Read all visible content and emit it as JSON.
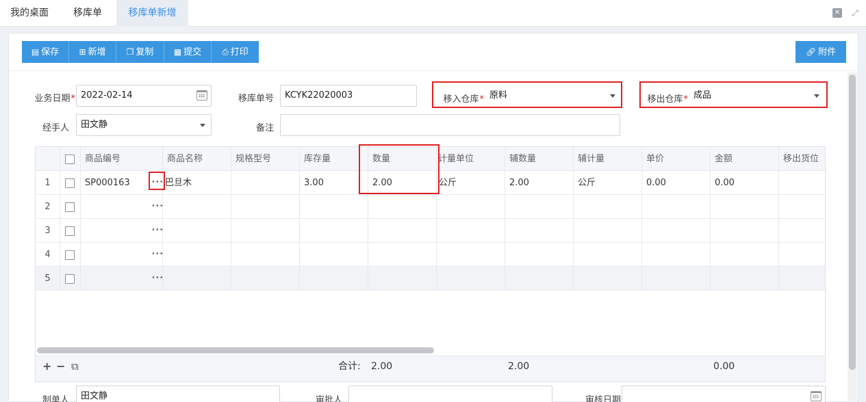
{
  "tabs": [
    {
      "label": "我的桌面",
      "active": false
    },
    {
      "label": "移库单",
      "active": false
    },
    {
      "label": "移库单新增",
      "active": true
    }
  ],
  "window_controls": {
    "close_glyph": "✕",
    "expand_glyph": "⤢"
  },
  "toolbar": {
    "save": "保存",
    "new": "新增",
    "copy": "复制",
    "submit": "提交",
    "print": "打印",
    "attachment": "附件"
  },
  "form": {
    "biz_date_label": "业务日期",
    "biz_date_value": "2022-02-14",
    "order_no_label": "移库单号",
    "order_no_value": "KCYK22020003",
    "in_wh_label": "移入仓库",
    "in_wh_value": "原料",
    "out_wh_label": "移出仓库",
    "out_wh_value": "成品",
    "handler_label": "经手人",
    "handler_value": "田文静",
    "remark_label": "备注",
    "remark_value": "",
    "required_mark": "*"
  },
  "grid": {
    "columns": [
      "商品编号",
      "商品名称",
      "规格型号",
      "库存量",
      "数量",
      "计量单位",
      "辅数量",
      "辅计量",
      "单价",
      "金额",
      "移出货位"
    ],
    "rows": [
      {
        "num": "1",
        "code": "SP000163",
        "name": "巴旦木",
        "spec": "",
        "stock": "3.00",
        "qty": "2.00",
        "unit": "公斤",
        "aux_qty": "2.00",
        "aux_unit": "公斤",
        "price": "0.00",
        "amount": "0.00",
        "loc": ""
      },
      {
        "num": "2",
        "code": "",
        "name": "",
        "spec": "",
        "stock": "",
        "qty": "",
        "unit": "",
        "aux_qty": "",
        "aux_unit": "",
        "price": "",
        "amount": "",
        "loc": ""
      },
      {
        "num": "3",
        "code": "",
        "name": "",
        "spec": "",
        "stock": "",
        "qty": "",
        "unit": "",
        "aux_qty": "",
        "aux_unit": "",
        "price": "",
        "amount": "",
        "loc": ""
      },
      {
        "num": "4",
        "code": "",
        "name": "",
        "spec": "",
        "stock": "",
        "qty": "",
        "unit": "",
        "aux_qty": "",
        "aux_unit": "",
        "price": "",
        "amount": "",
        "loc": ""
      },
      {
        "num": "5",
        "code": "",
        "name": "",
        "spec": "",
        "stock": "",
        "qty": "",
        "unit": "",
        "aux_qty": "",
        "aux_unit": "",
        "price": "",
        "amount": "",
        "loc": ""
      }
    ],
    "more_glyph": "•••",
    "footer": {
      "add": "+",
      "remove": "−",
      "copy_icon": "⧉",
      "total_label": "合计:",
      "total_qty": "2.00",
      "total_aux_qty": "2.00",
      "total_amount": "0.00"
    }
  },
  "bottom_form": {
    "creator_label": "制单人",
    "creator_value": "田文静",
    "reviewer_label": "审批人",
    "review_date_label": "审核日期"
  },
  "colors": {
    "accent": "#3a96e0",
    "highlight": "#e02020",
    "tab_active": "#3a8ee6"
  }
}
